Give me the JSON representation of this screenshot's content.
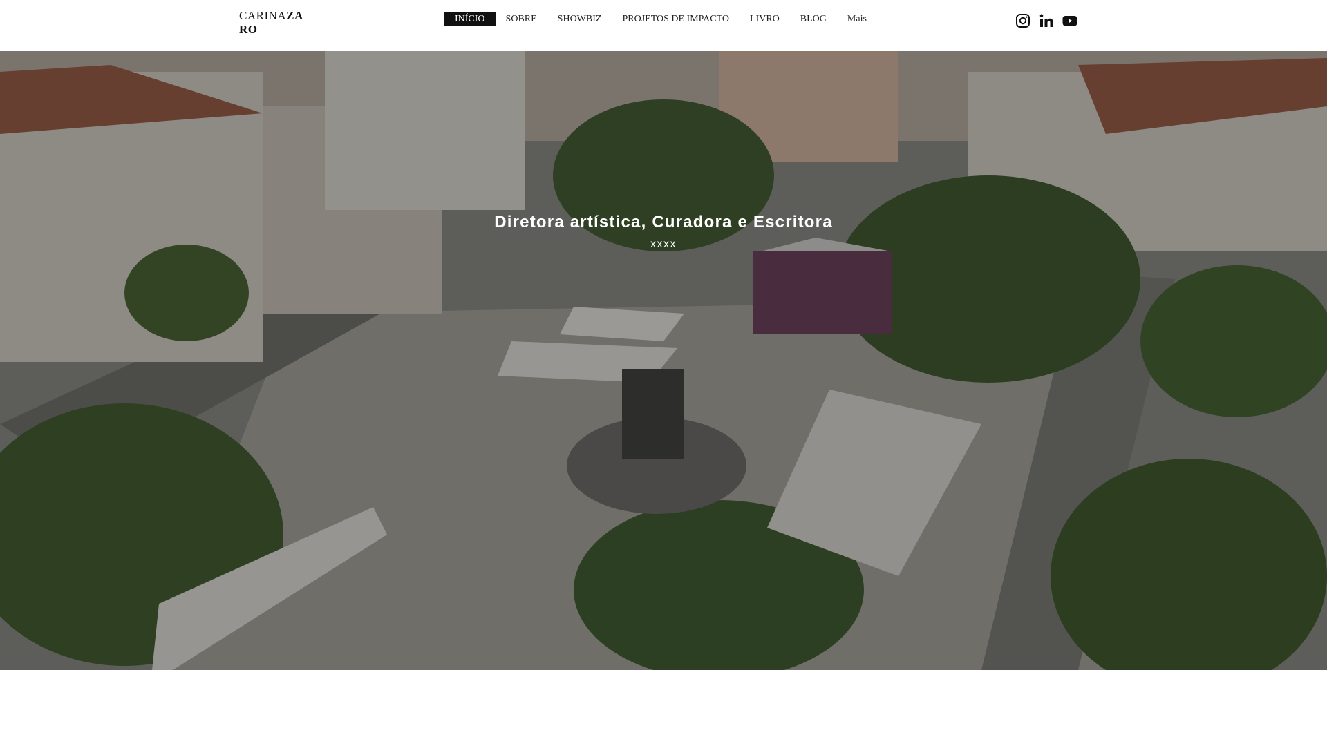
{
  "site": {
    "logo_line1_regular": "CARINA",
    "logo_line1_bold": "ZA",
    "logo_line2_bold": "RO"
  },
  "nav": {
    "items": [
      {
        "label": "INÍCIO",
        "active": true
      },
      {
        "label": "SOBRE",
        "active": false
      },
      {
        "label": "SHOWBIZ",
        "active": false
      },
      {
        "label": "PROJETOS DE IMPACTO",
        "active": false
      },
      {
        "label": "LIVRO",
        "active": false
      },
      {
        "label": "BLOG",
        "active": false
      },
      {
        "label": "Mais",
        "active": false
      }
    ]
  },
  "social": {
    "icons": [
      "instagram-icon",
      "linkedin-icon",
      "youtube-icon"
    ]
  },
  "hero": {
    "title": "Diretora artística, Curadora e Escritora",
    "subtitle": "xxxx"
  },
  "colors": {
    "nav_active_bg": "#111111",
    "nav_active_text": "#ffffff",
    "hero_text": "#ffffff"
  }
}
